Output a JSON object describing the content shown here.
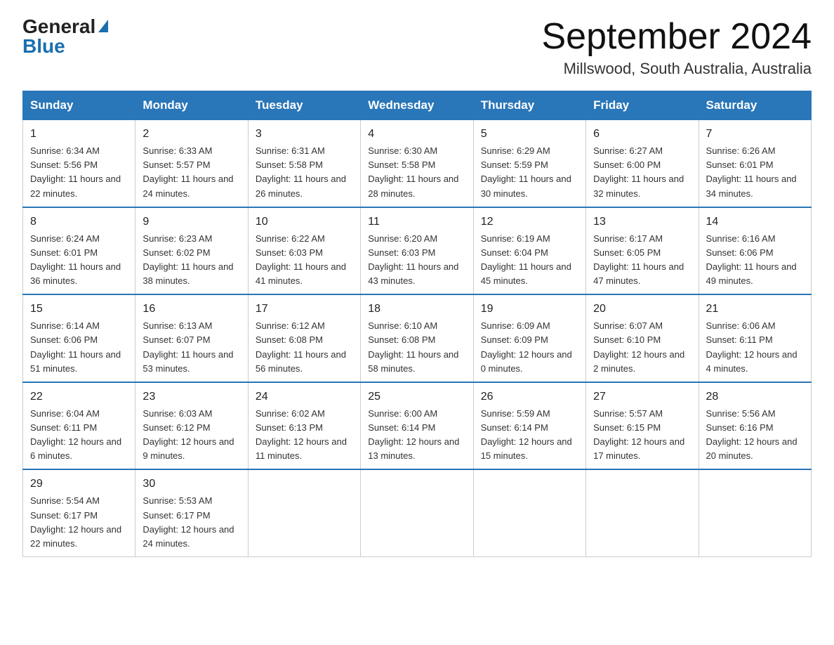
{
  "logo": {
    "general": "General",
    "blue": "Blue"
  },
  "header": {
    "title": "September 2024",
    "subtitle": "Millswood, South Australia, Australia"
  },
  "weekdays": [
    "Sunday",
    "Monday",
    "Tuesday",
    "Wednesday",
    "Thursday",
    "Friday",
    "Saturday"
  ],
  "weeks": [
    [
      {
        "day": "1",
        "sunrise": "6:34 AM",
        "sunset": "5:56 PM",
        "daylight": "11 hours and 22 minutes."
      },
      {
        "day": "2",
        "sunrise": "6:33 AM",
        "sunset": "5:57 PM",
        "daylight": "11 hours and 24 minutes."
      },
      {
        "day": "3",
        "sunrise": "6:31 AM",
        "sunset": "5:58 PM",
        "daylight": "11 hours and 26 minutes."
      },
      {
        "day": "4",
        "sunrise": "6:30 AM",
        "sunset": "5:58 PM",
        "daylight": "11 hours and 28 minutes."
      },
      {
        "day": "5",
        "sunrise": "6:29 AM",
        "sunset": "5:59 PM",
        "daylight": "11 hours and 30 minutes."
      },
      {
        "day": "6",
        "sunrise": "6:27 AM",
        "sunset": "6:00 PM",
        "daylight": "11 hours and 32 minutes."
      },
      {
        "day": "7",
        "sunrise": "6:26 AM",
        "sunset": "6:01 PM",
        "daylight": "11 hours and 34 minutes."
      }
    ],
    [
      {
        "day": "8",
        "sunrise": "6:24 AM",
        "sunset": "6:01 PM",
        "daylight": "11 hours and 36 minutes."
      },
      {
        "day": "9",
        "sunrise": "6:23 AM",
        "sunset": "6:02 PM",
        "daylight": "11 hours and 38 minutes."
      },
      {
        "day": "10",
        "sunrise": "6:22 AM",
        "sunset": "6:03 PM",
        "daylight": "11 hours and 41 minutes."
      },
      {
        "day": "11",
        "sunrise": "6:20 AM",
        "sunset": "6:03 PM",
        "daylight": "11 hours and 43 minutes."
      },
      {
        "day": "12",
        "sunrise": "6:19 AM",
        "sunset": "6:04 PM",
        "daylight": "11 hours and 45 minutes."
      },
      {
        "day": "13",
        "sunrise": "6:17 AM",
        "sunset": "6:05 PM",
        "daylight": "11 hours and 47 minutes."
      },
      {
        "day": "14",
        "sunrise": "6:16 AM",
        "sunset": "6:06 PM",
        "daylight": "11 hours and 49 minutes."
      }
    ],
    [
      {
        "day": "15",
        "sunrise": "6:14 AM",
        "sunset": "6:06 PM",
        "daylight": "11 hours and 51 minutes."
      },
      {
        "day": "16",
        "sunrise": "6:13 AM",
        "sunset": "6:07 PM",
        "daylight": "11 hours and 53 minutes."
      },
      {
        "day": "17",
        "sunrise": "6:12 AM",
        "sunset": "6:08 PM",
        "daylight": "11 hours and 56 minutes."
      },
      {
        "day": "18",
        "sunrise": "6:10 AM",
        "sunset": "6:08 PM",
        "daylight": "11 hours and 58 minutes."
      },
      {
        "day": "19",
        "sunrise": "6:09 AM",
        "sunset": "6:09 PM",
        "daylight": "12 hours and 0 minutes."
      },
      {
        "day": "20",
        "sunrise": "6:07 AM",
        "sunset": "6:10 PM",
        "daylight": "12 hours and 2 minutes."
      },
      {
        "day": "21",
        "sunrise": "6:06 AM",
        "sunset": "6:11 PM",
        "daylight": "12 hours and 4 minutes."
      }
    ],
    [
      {
        "day": "22",
        "sunrise": "6:04 AM",
        "sunset": "6:11 PM",
        "daylight": "12 hours and 6 minutes."
      },
      {
        "day": "23",
        "sunrise": "6:03 AM",
        "sunset": "6:12 PM",
        "daylight": "12 hours and 9 minutes."
      },
      {
        "day": "24",
        "sunrise": "6:02 AM",
        "sunset": "6:13 PM",
        "daylight": "12 hours and 11 minutes."
      },
      {
        "day": "25",
        "sunrise": "6:00 AM",
        "sunset": "6:14 PM",
        "daylight": "12 hours and 13 minutes."
      },
      {
        "day": "26",
        "sunrise": "5:59 AM",
        "sunset": "6:14 PM",
        "daylight": "12 hours and 15 minutes."
      },
      {
        "day": "27",
        "sunrise": "5:57 AM",
        "sunset": "6:15 PM",
        "daylight": "12 hours and 17 minutes."
      },
      {
        "day": "28",
        "sunrise": "5:56 AM",
        "sunset": "6:16 PM",
        "daylight": "12 hours and 20 minutes."
      }
    ],
    [
      {
        "day": "29",
        "sunrise": "5:54 AM",
        "sunset": "6:17 PM",
        "daylight": "12 hours and 22 minutes."
      },
      {
        "day": "30",
        "sunrise": "5:53 AM",
        "sunset": "6:17 PM",
        "daylight": "12 hours and 24 minutes."
      },
      null,
      null,
      null,
      null,
      null
    ]
  ],
  "labels": {
    "sunrise": "Sunrise: ",
    "sunset": "Sunset: ",
    "daylight": "Daylight: "
  }
}
